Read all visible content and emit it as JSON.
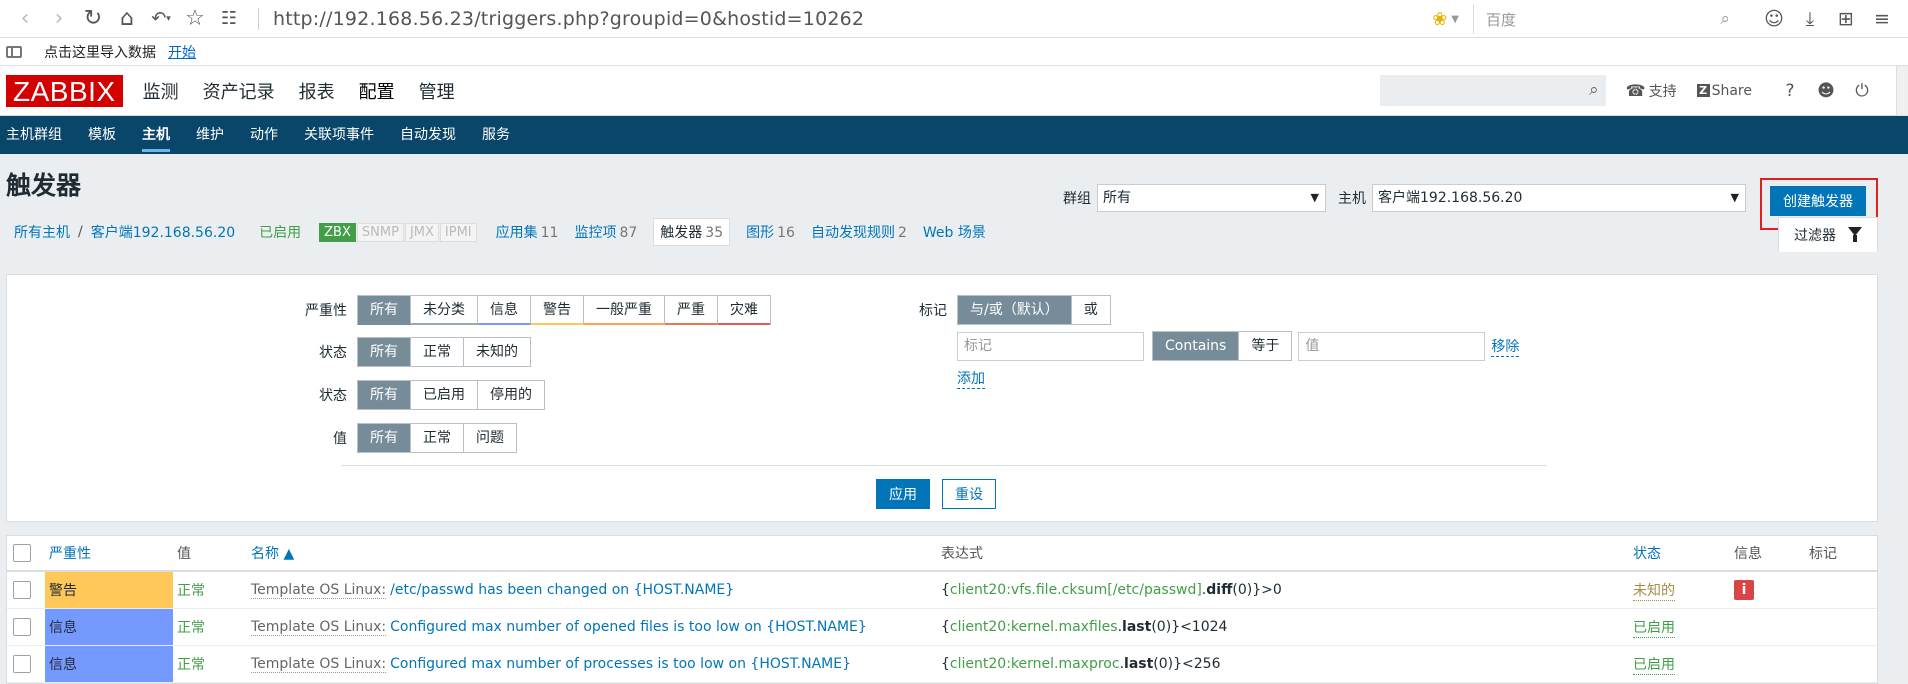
{
  "browser": {
    "url": "http://192.168.56.23/triggers.php?groupid=0&hostid=10262",
    "search_placeholder": "百度",
    "bookmark_text": "点击这里导入数据",
    "bookmark_link": "开始"
  },
  "header": {
    "logo": "ZABBIX",
    "main_menu": [
      "监测",
      "资产记录",
      "报表",
      "配置",
      "管理"
    ],
    "active_main": "配置",
    "support": "支持",
    "share": "Share",
    "help": "?",
    "sub_menu": [
      "主机群组",
      "模板",
      "主机",
      "维护",
      "动作",
      "关联项事件",
      "自动发现",
      "服务"
    ],
    "active_sub": "主机"
  },
  "page": {
    "title": "触发器",
    "group_label": "群组",
    "group_value": "所有",
    "host_label": "主机",
    "host_value": "客户端192.168.56.20",
    "create_button": "创建触发器"
  },
  "host_nav": {
    "all_hosts": "所有主机",
    "host": "客户端192.168.56.20",
    "enabled": "已启用",
    "availability": [
      "ZBX",
      "SNMP",
      "JMX",
      "IPMI"
    ],
    "tabs": [
      {
        "label": "应用集",
        "count": "11"
      },
      {
        "label": "监控项",
        "count": "87"
      },
      {
        "label": "触发器",
        "count": "35"
      },
      {
        "label": "图形",
        "count": "16"
      },
      {
        "label": "自动发现规则",
        "count": "2"
      },
      {
        "label": "Web 场景",
        "count": ""
      }
    ],
    "filter_tab": "过滤器"
  },
  "filter": {
    "severity_label": "严重性",
    "severity_options": [
      "所有",
      "未分类",
      "信息",
      "警告",
      "一般严重",
      "严重",
      "灾难"
    ],
    "severity_colors": [
      "#768d99",
      "#97aab3",
      "#7499ff",
      "#ffc859",
      "#ffa059",
      "#e97659",
      "#e45959"
    ],
    "state_label": "状态",
    "state_options": [
      "所有",
      "正常",
      "未知的"
    ],
    "status_label": "状态",
    "status_options": [
      "所有",
      "已启用",
      "停用的"
    ],
    "value_label": "值",
    "value_options": [
      "所有",
      "正常",
      "问题"
    ],
    "tags_label": "标记",
    "tags_mode_options": [
      "与/或（默认）",
      "或"
    ],
    "tag_placeholder": "标记",
    "tag_operator_options": [
      "Contains",
      "等于"
    ],
    "value_placeholder": "值",
    "remove_link": "移除",
    "add_link": "添加",
    "apply_button": "应用",
    "reset_button": "重设"
  },
  "table": {
    "headers": {
      "severity": "严重性",
      "value": "值",
      "name": "名称 ▲",
      "expression": "表达式",
      "status": "状态",
      "info": "信息",
      "tags": "标记"
    },
    "rows": [
      {
        "severity": "警告",
        "severity_color": "#ffc859",
        "value": "正常",
        "template": "Template OS Linux:",
        "name": "/etc/passwd has been changed on {HOST.NAME}",
        "expr_open": "{",
        "expr_item": "client20:vfs.file.cksum[/etc/passwd]",
        "expr_func": "diff",
        "expr_args": "(0)}>0",
        "status": "未知的",
        "status_color": "#a58e4a",
        "info": "i"
      },
      {
        "severity": "信息",
        "severity_color": "#7499ff",
        "value": "正常",
        "template": "Template OS Linux:",
        "name": "Configured max number of opened files is too low on {HOST.NAME}",
        "expr_open": "{",
        "expr_item": "client20:kernel.maxfiles",
        "expr_func": "last",
        "expr_args": "(0)}<1024",
        "status": "已启用",
        "status_color": "#429e47",
        "info": ""
      },
      {
        "severity": "信息",
        "severity_color": "#7499ff",
        "value": "正常",
        "template": "Template OS Linux:",
        "name": "Configured max number of processes is too low on {HOST.NAME}",
        "expr_open": "{",
        "expr_item": "client20:kernel.maxproc",
        "expr_func": "last",
        "expr_args": "(0)}<256",
        "status": "已启用",
        "status_color": "#429e47",
        "info": ""
      }
    ]
  }
}
